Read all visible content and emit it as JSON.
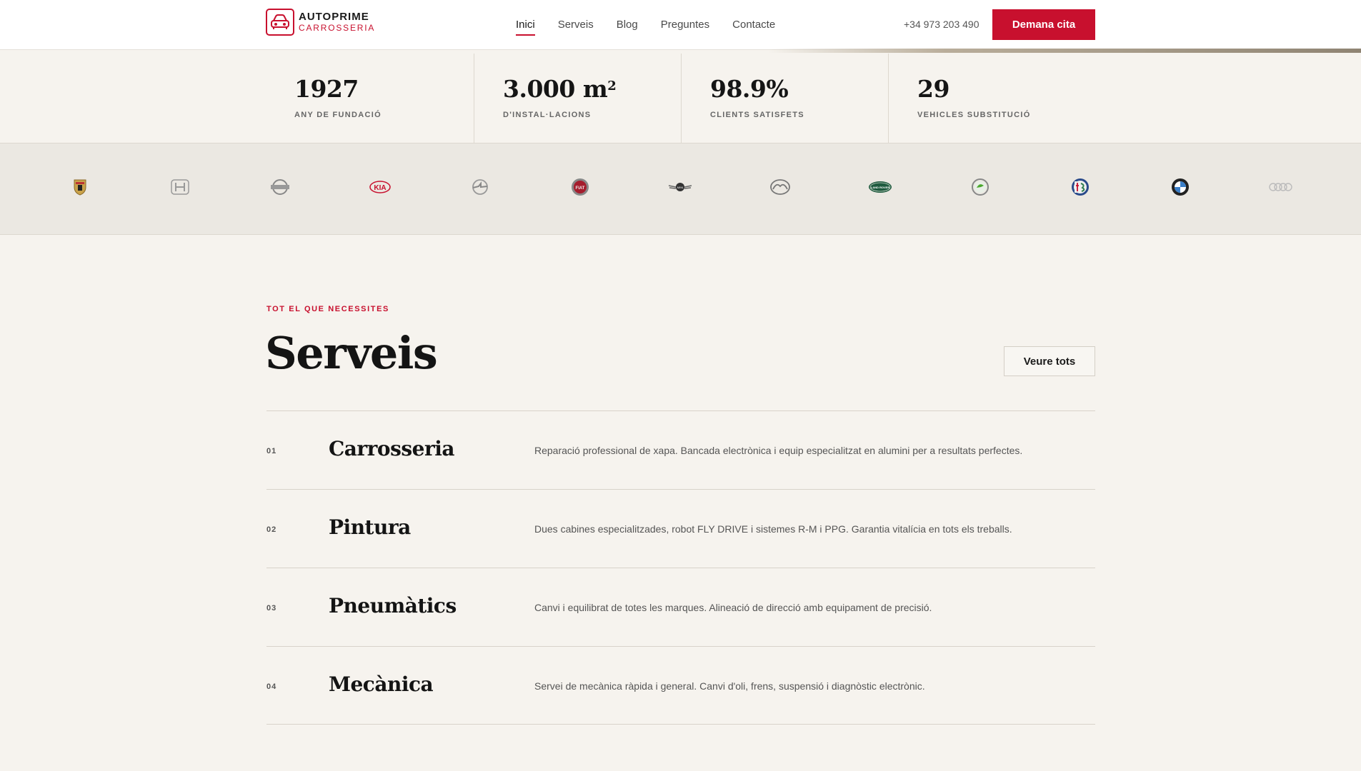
{
  "header": {
    "logo": {
      "title": "AUTOPRIME",
      "subtitle": "CARROSSERIA",
      "icon": "car-front-icon"
    },
    "nav": [
      {
        "label": "Inici",
        "active": true
      },
      {
        "label": "Serveis",
        "active": false
      },
      {
        "label": "Blog",
        "active": false
      },
      {
        "label": "Preguntes",
        "active": false
      },
      {
        "label": "Contacte",
        "active": false
      }
    ],
    "phone": "+34 973 203 490",
    "cta_label": "Demana cita"
  },
  "stats": [
    {
      "value": "1927",
      "sup": "",
      "label": "ANY DE FUNDACIÓ"
    },
    {
      "value": "3.000 m",
      "sup": "2",
      "label": "D'INSTAL·LACIONS"
    },
    {
      "value": "98.9%",
      "sup": "",
      "label": "CLIENTS SATISFETS"
    },
    {
      "value": "29",
      "sup": "",
      "label": "VEHICLES SUBSTITUCIÓ"
    }
  ],
  "brands": [
    {
      "icon": "porsche-logo-icon"
    },
    {
      "icon": "honda-logo-icon"
    },
    {
      "icon": "nissan-logo-icon"
    },
    {
      "icon": "kia-logo-icon",
      "text": "KIA"
    },
    {
      "icon": "opel-logo-icon"
    },
    {
      "icon": "fiat-logo-icon",
      "text": "FIAT"
    },
    {
      "icon": "mini-logo-icon",
      "text": "MINI"
    },
    {
      "icon": "mazda-logo-icon"
    },
    {
      "icon": "land-rover-logo-icon",
      "text": "LAND ROVER"
    },
    {
      "icon": "skoda-logo-icon"
    },
    {
      "icon": "alfa-romeo-logo-icon"
    },
    {
      "icon": "bmw-logo-icon"
    },
    {
      "icon": "audi-logo-icon"
    }
  ],
  "services_section": {
    "eyebrow": "TOT EL QUE NECESSITES",
    "title": "Serveis",
    "see_all_label": "Veure tots",
    "items": [
      {
        "number": "01",
        "name": "Carrosseria",
        "description": "Reparació professional de xapa. Bancada electrònica i equip especialitzat en alumini per a resultats perfectes."
      },
      {
        "number": "02",
        "name": "Pintura",
        "description": "Dues cabines especialitzades, robot FLY DRIVE i sistemes R-M i PPG. Garantia vitalícia en tots els treballs."
      },
      {
        "number": "03",
        "name": "Pneumàtics",
        "description": "Canvi i equilibrat de totes les marques. Alineació de direcció amb equipament de precisió."
      },
      {
        "number": "04",
        "name": "Mecànica",
        "description": "Servei de mecànica ràpida i general. Canvi d'oli, frens, suspensió i diagnòstic electrònic."
      }
    ]
  },
  "colors": {
    "accent": "#c8102e",
    "background": "#f6f3ee",
    "brand_strip": "#ebe8e2"
  }
}
